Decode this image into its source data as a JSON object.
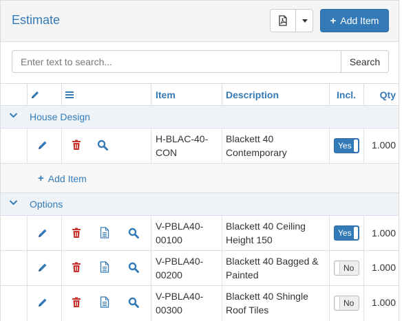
{
  "header": {
    "title": "Estimate",
    "add_item_label": "Add Item"
  },
  "search": {
    "placeholder": "Enter text to search...",
    "button_label": "Search"
  },
  "columns": {
    "item": "Item",
    "description": "Description",
    "included": "Incl.",
    "quantity": "Qty"
  },
  "groups": [
    {
      "label": "House Design",
      "add_label": "Add Item",
      "rows": [
        {
          "item_line1": "H-BLAC-40-",
          "item_line2": "CON",
          "desc_line1": "Blackett 40",
          "desc_line2": "Contemporary",
          "included": "Yes",
          "qty": "1.000"
        }
      ]
    },
    {
      "label": "Options",
      "rows": [
        {
          "item_line1": "V-PBLA40-",
          "item_line2": "00100",
          "desc_line1": "Blackett 40 Ceiling",
          "desc_line2": "Height 150",
          "included": "Yes",
          "qty": "1.000"
        },
        {
          "item_line1": "V-PBLA40-",
          "item_line2": "00200",
          "desc_line1": "Blackett 40 Bagged &",
          "desc_line2": "Painted",
          "included": "No",
          "qty": "1.000"
        },
        {
          "item_line1": "V-PBLA40-",
          "item_line2": "00300",
          "desc_line1": "Blackett 40 Shingle",
          "desc_line2": "Roof Tiles",
          "included": "No",
          "qty": "1.000"
        }
      ]
    }
  ],
  "colors": {
    "accent": "#337ab7",
    "delete": "#c9302c",
    "group_bg": "#eef3f8"
  },
  "icons": [
    "pdf-icon",
    "pencil-icon",
    "list-icon",
    "chevron-down-icon",
    "edit-icon",
    "trash-icon",
    "document-icon",
    "magnifier-icon",
    "plus-icon"
  ]
}
